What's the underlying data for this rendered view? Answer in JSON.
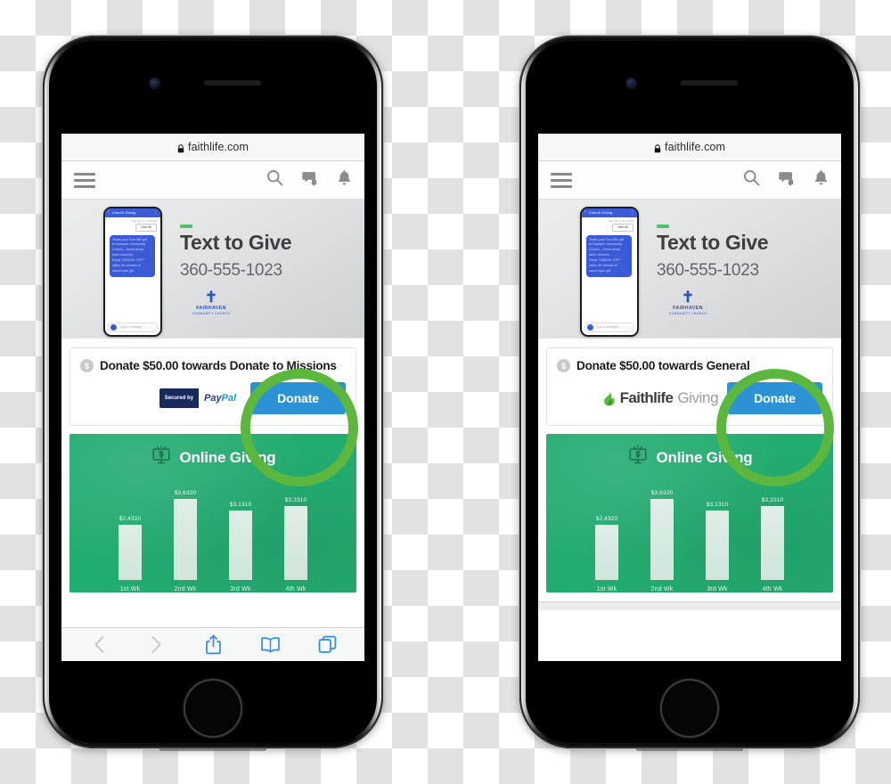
{
  "browser": {
    "url": "faithlife.com",
    "lock_icon": "lock-icon",
    "toolbar": {
      "back": "back-icon",
      "forward": "forward-icon",
      "share": "share-icon",
      "bookmarks": "book-icon",
      "tabs": "tabs-icon"
    }
  },
  "site_nav": {
    "menu": "hamburger-menu-icon",
    "search": "search-icon",
    "messages": "chat-bubbles-icon",
    "notifications": "bell-icon"
  },
  "hero": {
    "eyebrow_dash": "",
    "title": "Text to Give",
    "phone_number": "360-555-1023",
    "church": {
      "cross": "✝",
      "name": "FAIRHAVEN",
      "subtitle": "COMMUNITY CHURCH"
    },
    "sms_mockup": {
      "back_chevron": "‹",
      "conversation_title": "Church Giving",
      "menu_dots": "⋮",
      "timestamp": "Sat, Nov 4, 11:23 AM",
      "sent_message": "Give 50",
      "reply_lines": [
        "Thank you! Your $50 gift",
        "to Example Community",
        "Church – General has",
        "been received.",
        "Reply \"CANCEL GIFT\"",
        "within 30 minutes to",
        "cancel your gift."
      ],
      "input_placeholder": "Type a message..."
    }
  },
  "donate_left": {
    "coin_symbol": "$",
    "headline": "Donate $50.00 towards Donate to Missions",
    "badge": {
      "type": "paypal",
      "secured_by": "Secured by",
      "pay": "Pay",
      "pal": "Pal"
    },
    "button_label": "Donate"
  },
  "donate_right": {
    "coin_symbol": "$",
    "headline": "Donate $50.00 towards General",
    "badge": {
      "type": "faithlife",
      "brand": "Faithlife",
      "product": "Giving"
    },
    "button_label": "Donate"
  },
  "colors": {
    "highlight_ring": "#5bb73d",
    "donate_button": "#2b93d5",
    "chart_background": "#23ac70",
    "chart_bar": "#d6eae0",
    "accent_dash": "#4fc36a",
    "church_blue": "#2b53c4",
    "paypal_navy": "#253b80",
    "paypal_blue": "#179bd7",
    "faithlife_green": "#5bb73d"
  },
  "chart_data": {
    "type": "bar",
    "title": "Online Giving",
    "title_icon": "monitor-dollar-icon",
    "categories": [
      "1st Wk",
      "2nd Wk",
      "3rd Wk",
      "4th Wk"
    ],
    "value_labels": [
      "$2,4320",
      "$3,6320",
      "$3,1310",
      "$3,3310"
    ],
    "values": [
      24320,
      36320,
      31310,
      33310
    ],
    "xlabel": "",
    "ylabel": "",
    "ylim": [
      0,
      40000
    ],
    "grid": false,
    "legend": "none"
  }
}
